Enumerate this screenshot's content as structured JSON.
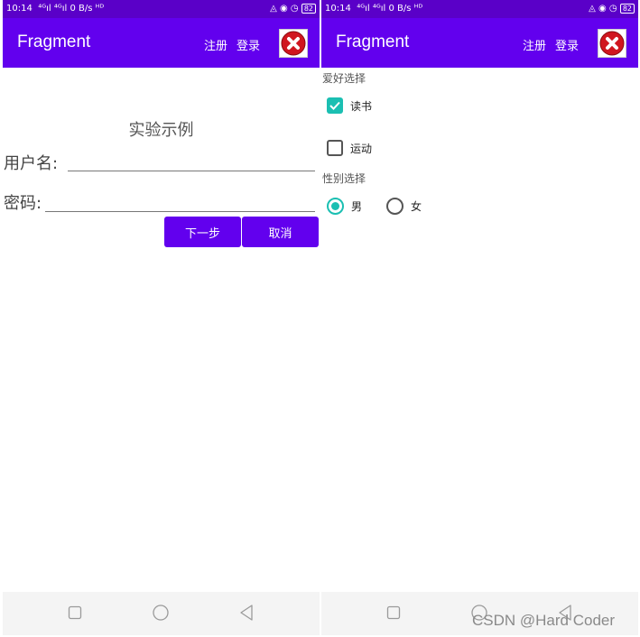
{
  "status_bar": {
    "time": "10:14",
    "signal_text": "ᵀˡᴵ ᵀˡᴵ 0 B/s",
    "battery": "82"
  },
  "app_bar": {
    "title": "Fragment",
    "menu_register": "注册",
    "menu_login": "登录",
    "close_icon": "close-icon",
    "close_color": "#d0161f"
  },
  "login_screen": {
    "heading": "实验示例",
    "username_label": "用户名:",
    "username_value": "",
    "password_label": "密码:",
    "password_value": "",
    "next_button": "下一步",
    "cancel_button": "取消"
  },
  "preference_screen": {
    "hobby_section": "爱好选择",
    "hobbies": [
      {
        "label": "读书",
        "checked": true
      },
      {
        "label": "运动",
        "checked": false
      }
    ],
    "gender_section": "性别选择",
    "genders": [
      {
        "label": "男",
        "selected": true
      },
      {
        "label": "女",
        "selected": false
      }
    ]
  },
  "navigation": {
    "icons": [
      "recent-apps-icon",
      "home-icon",
      "back-icon"
    ]
  },
  "watermark": "CSDN @Hard Coder",
  "colors": {
    "status_bar": "#5a00c8",
    "app_bar": "#6200ee",
    "accent": "#1bbfb2",
    "button": "#6200ee"
  }
}
